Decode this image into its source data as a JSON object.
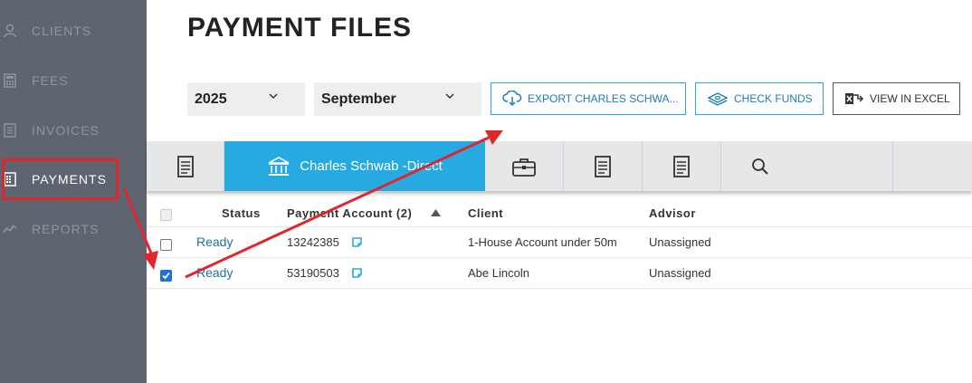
{
  "sidebar": {
    "items": [
      {
        "label": "CLIENTS",
        "icon": "clients-icon"
      },
      {
        "label": "FEES",
        "icon": "calculator-icon"
      },
      {
        "label": "INVOICES",
        "icon": "invoice-icon"
      },
      {
        "label": "PAYMENTS",
        "icon": "payments-icon"
      },
      {
        "label": "REPORTS",
        "icon": "reports-icon"
      }
    ],
    "active": "PAYMENTS"
  },
  "header": {
    "title": "PAYMENT FILES"
  },
  "filters": {
    "year": "2025",
    "month": "September"
  },
  "toolbar": {
    "export_label": "EXPORT CHARLES SCHWA...",
    "check_funds_label": "CHECK FUNDS",
    "view_excel_label": "VIEW IN EXCEL"
  },
  "tabs": {
    "active_label": "Charles Schwab -Direct"
  },
  "table": {
    "columns": {
      "status": "Status",
      "account": "Payment Account (2)",
      "client": "Client",
      "advisor": "Advisor"
    },
    "rows": [
      {
        "status": "Ready",
        "account": "13242385",
        "client": "1-House Account under 50m",
        "advisor": "Unassigned",
        "checked": false
      },
      {
        "status": "Ready",
        "account": "53190503",
        "client": "Abe Lincoln",
        "advisor": "Unassigned",
        "checked": true
      }
    ]
  },
  "colors": {
    "sidebar_bg": "#5e6570",
    "accent": "#27aae1",
    "annotation_red": "#e0262b",
    "link_blue": "#1f6fa6"
  }
}
